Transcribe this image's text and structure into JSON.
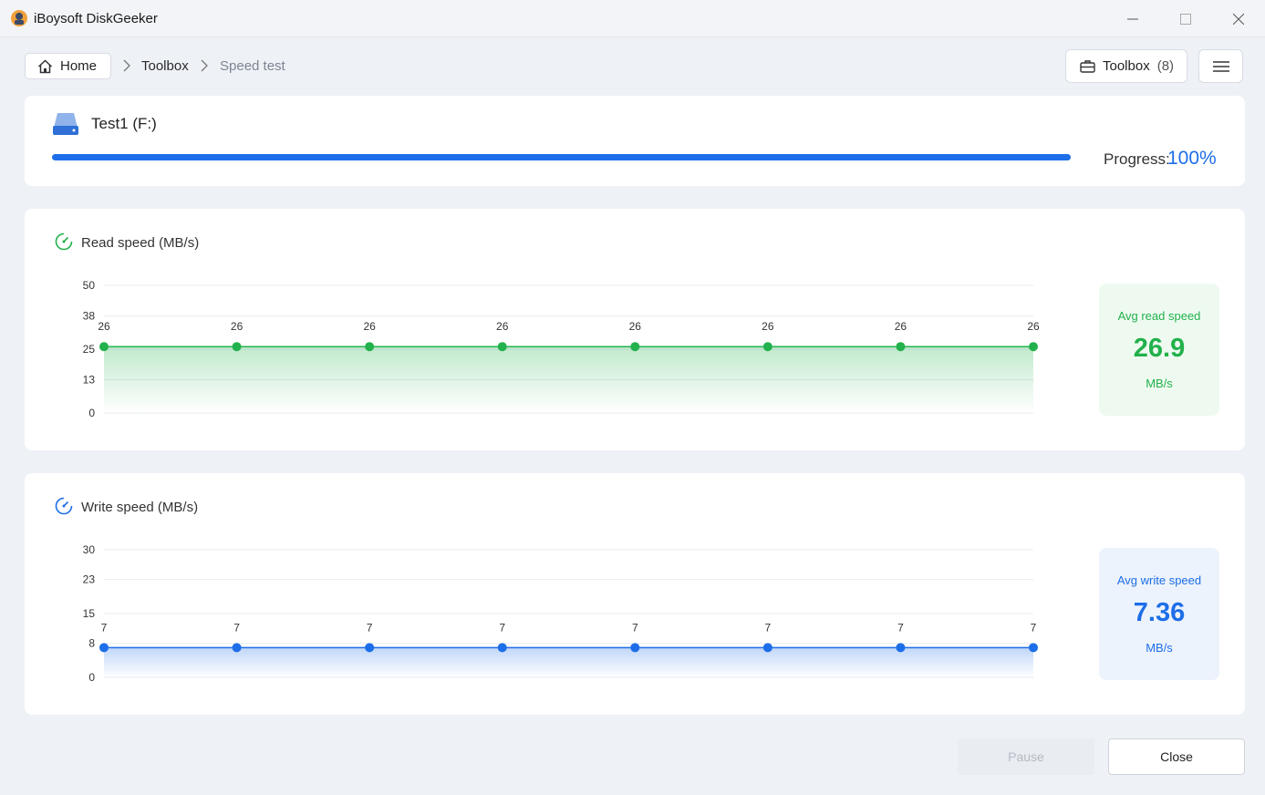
{
  "window": {
    "title": "iBoysoft DiskGeeker",
    "controls": [
      "minimize-icon",
      "maximize-icon",
      "close-icon"
    ]
  },
  "breadcrumb": {
    "home": "Home",
    "items": [
      "Toolbox",
      "Speed test"
    ]
  },
  "toolbar": {
    "toolbox_label": "Toolbox",
    "toolbox_count": "(8)",
    "menu_icon": "hamburger-menu-icon"
  },
  "drive": {
    "name": "Test1 (F:)",
    "icon": "drive-icon",
    "progress_label": "Progress:",
    "progress_value": "100%",
    "progress_fraction": 1.0
  },
  "read": {
    "title": "Read speed (MB/s)",
    "avg_label": "Avg read speed",
    "avg_value": "26.9",
    "avg_unit": "MB/s"
  },
  "write": {
    "title": "Write speed (MB/s)",
    "avg_label": "Avg write speed",
    "avg_value": "7.36",
    "avg_unit": "MB/s"
  },
  "buttons": {
    "pause": "Pause",
    "close": "Close"
  },
  "colors": {
    "accent_blue": "#1d6ee8",
    "read_green": "#22b14c"
  },
  "chart_data": [
    {
      "type": "area",
      "ylabel": "Read speed (MB/s)",
      "yticks": [
        0,
        13,
        25,
        38,
        50
      ],
      "ylim": [
        0,
        50
      ],
      "x": [
        1,
        2,
        3,
        4,
        5,
        6,
        7,
        8
      ],
      "series": [
        {
          "values": [
            26,
            26,
            26,
            26,
            26,
            26,
            26,
            26
          ],
          "labels": [
            "26",
            "26",
            "26",
            "26",
            "26",
            "26",
            "26",
            "26"
          ],
          "color": "#22b14c"
        }
      ],
      "grid": true
    },
    {
      "type": "area",
      "ylabel": "Write speed (MB/s)",
      "yticks": [
        0,
        8,
        15,
        23,
        30
      ],
      "ylim": [
        0,
        30
      ],
      "x": [
        1,
        2,
        3,
        4,
        5,
        6,
        7,
        8
      ],
      "series": [
        {
          "values": [
            7,
            7,
            7,
            7,
            7,
            7,
            7,
            7
          ],
          "labels": [
            "7",
            "7",
            "7",
            "7",
            "7",
            "7",
            "7",
            "7"
          ],
          "color": "#1d6ee8"
        }
      ],
      "grid": true
    }
  ]
}
